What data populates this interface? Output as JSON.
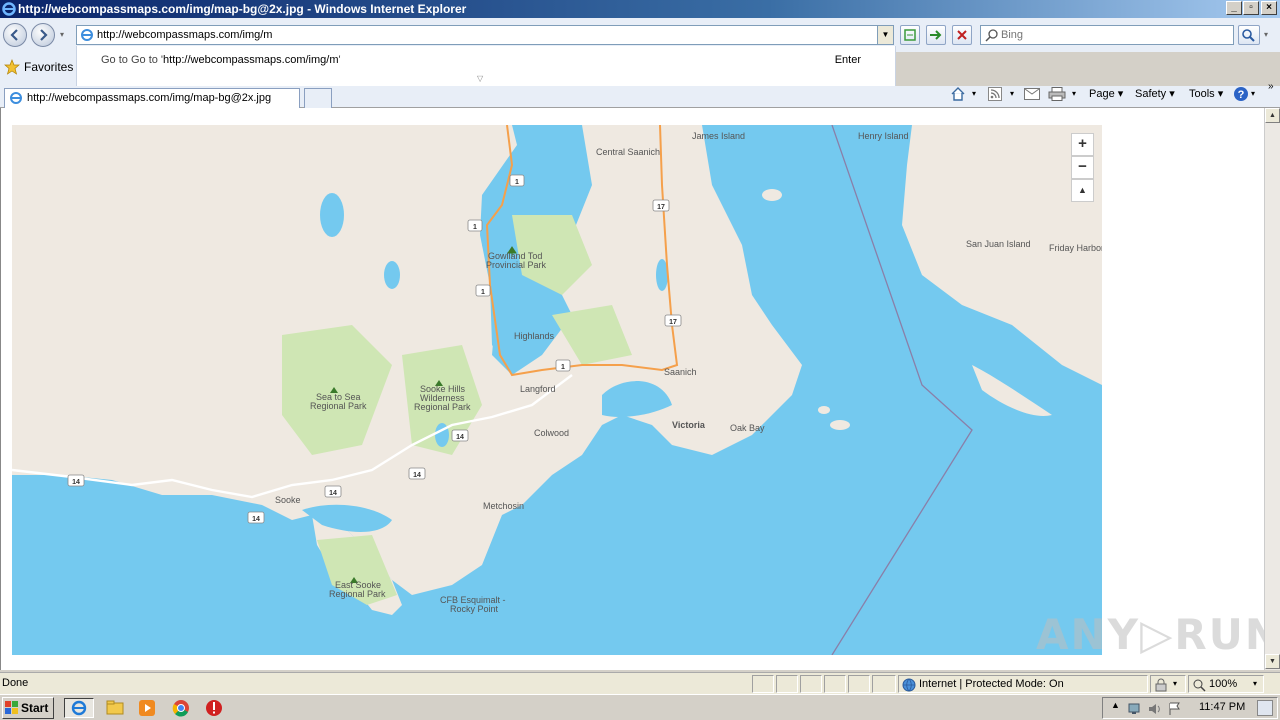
{
  "window": {
    "title": "http://webcompassmaps.com/img/map-bg@2x.jpg - Windows Internet Explorer",
    "controls": [
      "_",
      "▫",
      "×"
    ]
  },
  "address": {
    "value": "http://webcompassmaps.com/img/m",
    "suggestion_prefix": "Go to '",
    "suggestion_url": "http://webcompassmaps.com/img/m",
    "suggestion_suffix": "'",
    "enter_label": "Enter"
  },
  "search": {
    "placeholder": "Bing"
  },
  "favorites": {
    "label": "Favorites"
  },
  "tabs": [
    {
      "label": "http://webcompassmaps.com/img/map-bg@2x.jpg"
    }
  ],
  "commandbar": {
    "page": "Page ▾",
    "safety": "Safety ▾",
    "tools": "Tools ▾",
    "help": "▾"
  },
  "map": {
    "places": [
      "Central Saanich",
      "James Island",
      "Henry Island",
      "San Juan Island",
      "Friday Harbor",
      "Gowlland Tod Provincial Park",
      "Highlands",
      "Langford",
      "Saanich",
      "Victoria",
      "Oak Bay",
      "Colwood",
      "Sea to Sea Regional Park",
      "Sooke Hills Wilderness Regional Park",
      "Sooke",
      "Metchosin",
      "East Sooke Regional Park",
      "CFB Esquimalt - Rocky Point"
    ],
    "labels": {
      "central_saanich": "Central Saanich",
      "james_island": "James Island",
      "henry_island": "Henry Island",
      "san_juan": "San Juan Island",
      "friday_harbor": "Friday Harbor",
      "gowlland_1": "Gowlland Tod",
      "gowlland_2": "Provincial Park",
      "highlands": "Highlands",
      "langford": "Langford",
      "saanich": "Saanich",
      "victoria": "Victoria",
      "oak_bay": "Oak Bay",
      "colwood": "Colwood",
      "seatosea_1": "Sea to Sea",
      "seatosea_2": "Regional Park",
      "sookehills_1": "Sooke Hills",
      "sookehills_2": "Wilderness",
      "sookehills_3": "Regional Park",
      "sooke": "Sooke",
      "metchosin": "Metchosin",
      "eastsooke_1": "East Sooke",
      "eastsooke_2": "Regional Park",
      "cfb_1": "CFB Esquimalt -",
      "cfb_2": "Rocky Point"
    },
    "route_shields": [
      "1",
      "17",
      "14"
    ],
    "zoom_in": "+",
    "zoom_out": "−",
    "reset": "▲"
  },
  "watermark": "ANY▷RUN",
  "status": {
    "text": "Done",
    "zone": "Internet | Protected Mode: On",
    "zoom": "100%"
  },
  "taskbar": {
    "start": "Start",
    "clock": "11:47 PM"
  },
  "colors": {
    "water": "#74c9ef",
    "land": "#efe9e1",
    "park": "#cfe6b4",
    "highway": "#f5a04b"
  }
}
